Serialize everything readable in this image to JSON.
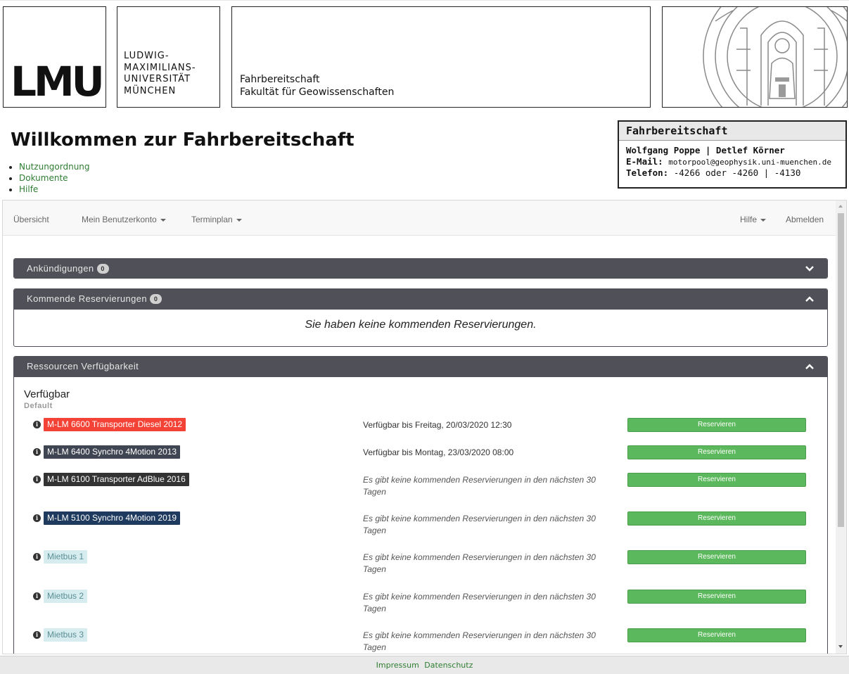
{
  "header": {
    "logo_text": "LMU",
    "university_lines": [
      "LUDWIG-",
      "MAXIMILIANS-",
      "UNIVERSITÄT",
      "MÜNCHEN"
    ],
    "department_lines": [
      "Fahrbereitschaft",
      "Fakultät für Geowissenschaften"
    ],
    "seal_icon": "university-seal-icon"
  },
  "page": {
    "title": "Willkommen zur Fahrbereitschaft",
    "links": [
      "Nutzungordnung",
      "Dokumente",
      "Hilfe"
    ]
  },
  "contact": {
    "heading": "Fahrbereitschaft",
    "names": "Wolfgang Poppe | Detlef Körner",
    "email_label": "E-Mail:",
    "email": "motorpool@geophysik.uni-muenchen.de",
    "phone_label": "Telefon:",
    "phone": "-4266 oder -4260 | -4130"
  },
  "navbar": {
    "overview": "Übersicht",
    "account": "Mein Benutzerkonto",
    "schedule": "Terminplan",
    "help": "Hilfe",
    "logout": "Abmelden"
  },
  "panels": {
    "announcements": {
      "title": "Ankündigungen",
      "count": "0"
    },
    "upcoming": {
      "title": "Kommende Reservierungen",
      "count": "0",
      "empty_message": "Sie haben keine kommenden Reservierungen."
    },
    "availability": {
      "title": "Ressourcen Verfügbarkeit",
      "section_title": "Verfügbar",
      "section_subtitle": "Default"
    }
  },
  "resources": [
    {
      "name": "M-LM 6600 Transporter Diesel 2012",
      "status": "Verfügbar bis Freitag, 20/03/2020 12:30",
      "button": "Reservieren",
      "color": "#f44336",
      "text_color": "#ffffff",
      "italic": false
    },
    {
      "name": "M-LM 6400 Synchro 4Motion 2013",
      "status": "Verfügbar bis Montag, 23/03/2020 08:00",
      "button": "Reservieren",
      "color": "#3f4552",
      "text_color": "#ffffff",
      "italic": false
    },
    {
      "name": "M-LM 6100 Transporter AdBlue 2016",
      "status": "Es gibt keine kommenden Reservierungen in den nächsten 30 Tagen",
      "button": "Reservieren",
      "color": "#333333",
      "text_color": "#ffffff",
      "italic": true
    },
    {
      "name": "M-LM 5100 Synchro 4Motion 2019",
      "status": "Es gibt keine kommenden Reservierungen in den nächsten 30 Tagen",
      "button": "Reservieren",
      "color": "#1e3a5f",
      "text_color": "#ffffff",
      "italic": true
    },
    {
      "name": "Mietbus 1",
      "status": "Es gibt keine kommenden Reservierungen in den nächsten 30 Tagen",
      "button": "Reservieren",
      "color": "#d6ecef",
      "text_color": "#5a8f96",
      "italic": true
    },
    {
      "name": "Mietbus 2",
      "status": "Es gibt keine kommenden Reservierungen in den nächsten 30 Tagen",
      "button": "Reservieren",
      "color": "#d6ecef",
      "text_color": "#5a8f96",
      "italic": true
    },
    {
      "name": "Mietbus 3",
      "status": "Es gibt keine kommenden Reservierungen in den nächsten 30 Tagen",
      "button": "Reservieren",
      "color": "#d6ecef",
      "text_color": "#5a8f96",
      "italic": true
    }
  ],
  "footer": {
    "impressum": "Impressum",
    "privacy": "Datenschutz"
  }
}
